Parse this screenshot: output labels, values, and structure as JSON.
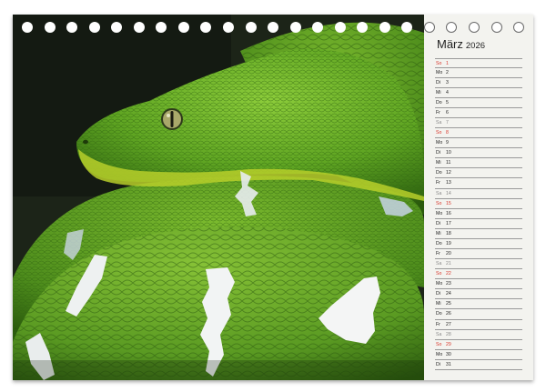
{
  "calendar": {
    "month": "März",
    "year": "2026",
    "days": [
      {
        "wd": "So",
        "d": "1",
        "kind": "sun"
      },
      {
        "wd": "Mo",
        "d": "2",
        "kind": "week"
      },
      {
        "wd": "Di",
        "d": "3",
        "kind": "week"
      },
      {
        "wd": "Mi",
        "d": "4",
        "kind": "week"
      },
      {
        "wd": "Do",
        "d": "5",
        "kind": "week"
      },
      {
        "wd": "Fr",
        "d": "6",
        "kind": "week"
      },
      {
        "wd": "Sa",
        "d": "7",
        "kind": "sat"
      },
      {
        "wd": "So",
        "d": "8",
        "kind": "sun"
      },
      {
        "wd": "Mo",
        "d": "9",
        "kind": "week"
      },
      {
        "wd": "Di",
        "d": "10",
        "kind": "week"
      },
      {
        "wd": "Mi",
        "d": "11",
        "kind": "week"
      },
      {
        "wd": "Do",
        "d": "12",
        "kind": "week"
      },
      {
        "wd": "Fr",
        "d": "13",
        "kind": "week"
      },
      {
        "wd": "Sa",
        "d": "14",
        "kind": "sat"
      },
      {
        "wd": "So",
        "d": "15",
        "kind": "sun"
      },
      {
        "wd": "Mo",
        "d": "16",
        "kind": "week"
      },
      {
        "wd": "Di",
        "d": "17",
        "kind": "week"
      },
      {
        "wd": "Mi",
        "d": "18",
        "kind": "week"
      },
      {
        "wd": "Do",
        "d": "19",
        "kind": "week"
      },
      {
        "wd": "Fr",
        "d": "20",
        "kind": "week"
      },
      {
        "wd": "Sa",
        "d": "21",
        "kind": "sat"
      },
      {
        "wd": "So",
        "d": "22",
        "kind": "sun"
      },
      {
        "wd": "Mo",
        "d": "23",
        "kind": "week"
      },
      {
        "wd": "Di",
        "d": "24",
        "kind": "week"
      },
      {
        "wd": "Mi",
        "d": "25",
        "kind": "week"
      },
      {
        "wd": "Do",
        "d": "26",
        "kind": "week"
      },
      {
        "wd": "Fr",
        "d": "27",
        "kind": "week"
      },
      {
        "wd": "Sa",
        "d": "28",
        "kind": "sat"
      },
      {
        "wd": "So",
        "d": "29",
        "kind": "sun"
      },
      {
        "wd": "Mo",
        "d": "30",
        "kind": "week"
      },
      {
        "wd": "Di",
        "d": "31",
        "kind": "week"
      }
    ]
  },
  "colors": {
    "sunday": "#d8362b",
    "saturday": "#8a8a8a",
    "snake_green": "#5a9a22",
    "background_dark": "#1c2418"
  },
  "photo": {
    "subject": "green-snake-icon"
  }
}
